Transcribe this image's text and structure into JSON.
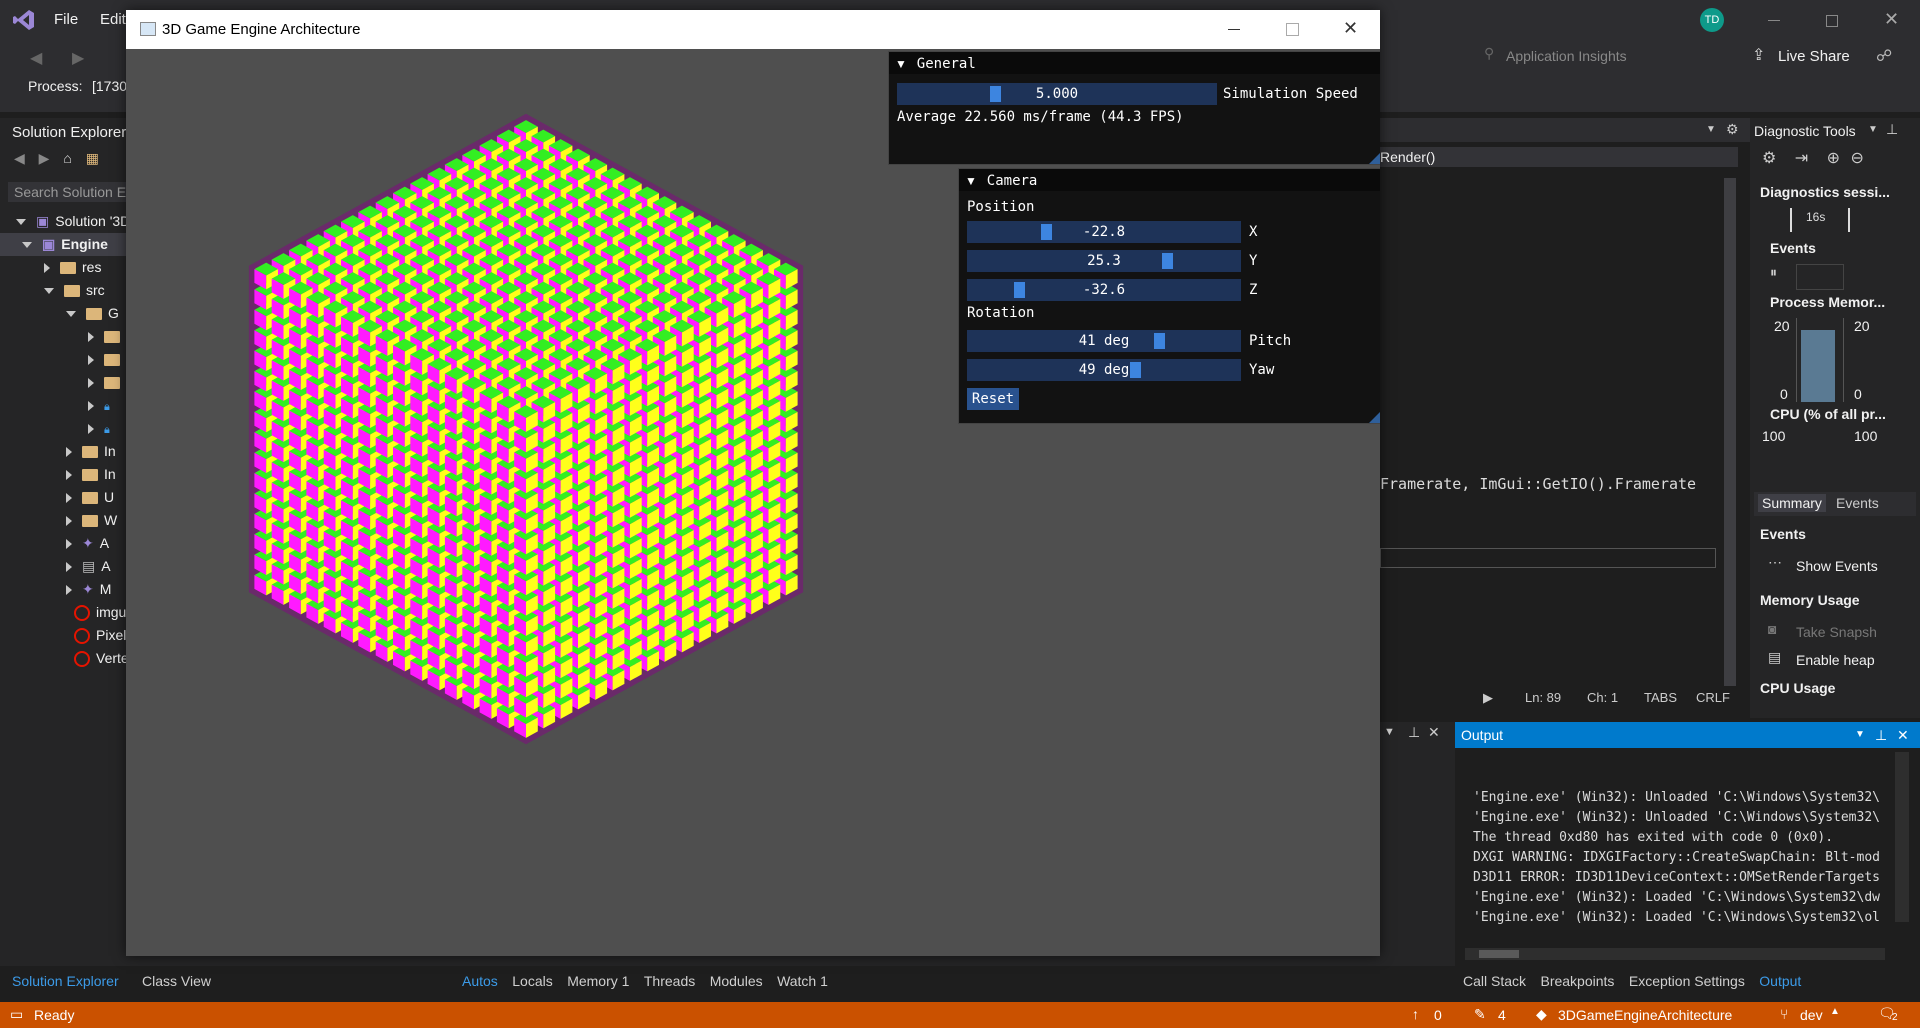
{
  "vs": {
    "menu": [
      "File",
      "Edit"
    ],
    "process_label": "Process:",
    "process_value": "[1730",
    "avatar": "TD",
    "application_insights": "Application Insights",
    "live_share": "Live Share",
    "editor_combo": "Render()",
    "code_line": "Framerate, ImGui::GetIO().Framerate",
    "editor_status": {
      "ln": "Ln: 89",
      "ch": "Ch: 1",
      "tabs": "TABS",
      "crlf": "CRLF"
    }
  },
  "solution_explorer": {
    "title": "Solution Explorer",
    "search_placeholder": "Search Solution E",
    "items": [
      {
        "label": "Solution '3D"
      },
      {
        "label": "Engine"
      },
      {
        "label": "res"
      },
      {
        "label": "src"
      },
      {
        "label": "G"
      },
      {
        "label": "In"
      },
      {
        "label": "In"
      },
      {
        "label": "U"
      },
      {
        "label": "W"
      },
      {
        "label": "A"
      },
      {
        "label": "A"
      },
      {
        "label": "M"
      },
      {
        "label": "imgu"
      },
      {
        "label": "Pixel"
      },
      {
        "label": "Verte"
      }
    ],
    "tabs": [
      "Solution Explorer",
      "Class View"
    ]
  },
  "debug_tabs": [
    "Autos",
    "Locals",
    "Memory 1",
    "Threads",
    "Modules",
    "Watch 1"
  ],
  "output_tabs": [
    "Call Stack",
    "Breakpoints",
    "Exception Settings",
    "Output"
  ],
  "diagnostic_tools": {
    "title": "Diagnostic Tools",
    "session": "Diagnostics sessi...",
    "timer": "16s",
    "events": "Events",
    "process_memory": "Process Memor...",
    "mem_top_left": "20",
    "mem_top_right": "20",
    "mem_bottom_left": "0",
    "mem_bottom_right": "0",
    "cpu": "CPU (% of all pr...",
    "cpu_left": "100",
    "cpu_right": "100",
    "tabs": [
      "Summary",
      "Events"
    ],
    "events_header": "Events",
    "show_events": "Show Events",
    "memory_usage": "Memory Usage",
    "take_snapshot": "Take Snapsh",
    "enable_heap": "Enable heap",
    "cpu_usage": "CPU Usage"
  },
  "output": {
    "title": "Output",
    "lines": [
      "'Engine.exe' (Win32): Unloaded 'C:\\Windows\\System32\\",
      "'Engine.exe' (Win32): Unloaded 'C:\\Windows\\System32\\",
      "The thread 0xd80 has exited with code 0 (0x0).",
      "DXGI WARNING: IDXGIFactory::CreateSwapChain: Blt-mod",
      "D3D11 ERROR: ID3D11DeviceContext::OMSetRenderTargets",
      "'Engine.exe' (Win32): Loaded 'C:\\Windows\\System32\\dw",
      "'Engine.exe' (Win32): Loaded 'C:\\Windows\\System32\\ol"
    ]
  },
  "status": {
    "ready": "Ready",
    "up": "0",
    "edits": "4",
    "repo": "3DGameEngineArchitecture",
    "branch": "dev",
    "notif": "2"
  },
  "app": {
    "title": "3D Game Engine Architecture",
    "general": {
      "title": "General",
      "speed_value": "5.000",
      "speed_fraction": 0.3,
      "speed_label": "Simulation Speed",
      "average": "Average 22.560 ms/frame (44.3 FPS)"
    },
    "camera": {
      "title": "Camera",
      "position_label": "Position",
      "rotation_label": "Rotation",
      "pos": [
        {
          "value": "-22.8",
          "fraction": 0.28,
          "axis": "X"
        },
        {
          "value": "25.3",
          "fraction": 0.74,
          "axis": "Y"
        },
        {
          "value": "-32.6",
          "fraction": 0.18,
          "axis": "Z"
        }
      ],
      "rot": [
        {
          "value": "41 deg",
          "fraction": 0.71,
          "axis": "Pitch"
        },
        {
          "value": "49 deg",
          "fraction": 0.62,
          "axis": "Yaw"
        }
      ],
      "reset": "Reset"
    }
  },
  "colors": {
    "cube_top": "#33ee22",
    "cube_left": "#ff1aff",
    "cube_right": "#ffff1a",
    "accent": "#007acc",
    "status": "#ca5100"
  }
}
